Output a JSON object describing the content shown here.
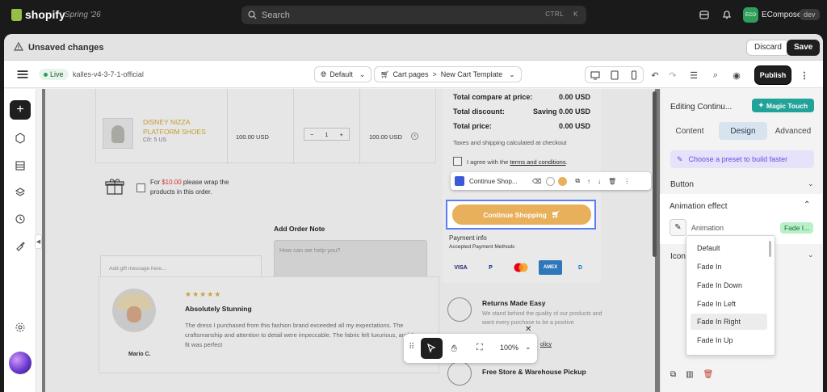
{
  "topbar": {
    "brand": "shopify",
    "edition": "Spring '26",
    "search_placeholder": "Search",
    "shortcut_ctrl": "CTRL",
    "shortcut_key": "K",
    "store_initials": "ECO",
    "store_name": "EComposer",
    "dev_badge": "dev"
  },
  "unsaved": {
    "message": "Unsaved changes",
    "discard": "Discard",
    "save": "Save"
  },
  "toolbar": {
    "live": "Live",
    "project": "kalles-v4-3-7-1-official",
    "language": "Default",
    "breadcrumb_1": "Cart pages",
    "breadcrumb_sep": ">",
    "breadcrumb_2": "New Cart Template",
    "publish": "Publish"
  },
  "cart": {
    "product_name": "DISNEY NIZZA PLATFORM SHOES",
    "product_size": "Cỡ: 5 US",
    "price": "100.00 USD",
    "qty_minus": "−",
    "qty": "1",
    "qty_plus": "+",
    "line_total": "100.00 USD",
    "gift_prefix": "For ",
    "gift_price": "$10.00",
    "gift_suffix": " please wrap the products in this order.",
    "gift_placeholder": "Add gift message here...",
    "note_heading": "Add Order Note",
    "note_placeholder": "How can we help you?"
  },
  "review": {
    "stars": "★★★★★",
    "title": "Absolutely Stunning",
    "body": "The dress I purchased from this fashion brand exceeded all my expectations. The craftsmanship and attention to detail were impeccable. The fabric felt luxurious, and the fit was perfect",
    "author": "Mario C."
  },
  "summary": {
    "compare_label": "Total compare at price:",
    "compare_value": "0.00 USD",
    "discount_label": "Total discount:",
    "discount_value": "Saving 0.00 USD",
    "total_label": "Total price:",
    "total_value": "0.00 USD",
    "tax_note": "Taxes and shipping calculated at checkout",
    "agree_prefix": "I agree with the ",
    "agree_link": "terms and conditions",
    "agree_suffix": ".",
    "float_label": "Continue Shop...",
    "cta": "Continue Shopping",
    "payment_info": "Payment info",
    "accepted": "Accepted Payment Methods",
    "cards": [
      "VISA",
      "P",
      "MC",
      "AMEX",
      "D"
    ]
  },
  "features": {
    "f1_title": "Returns Made Easy",
    "f1_body": "We stand behind the quality of our products and want every purchase to be a positive",
    "f1_link": "olicy",
    "f2_title": "Free Store & Warehouse Pickup"
  },
  "canvas_toolbar": {
    "zoom": "100%"
  },
  "panel": {
    "title": "Editing Continu...",
    "magic": "Magic Touch",
    "tabs": [
      "Content",
      "Design",
      "Advanced"
    ],
    "active_tab": "Design",
    "preset": "Choose a preset to build faster",
    "section_button": "Button",
    "section_animation": "Animation effect",
    "animation_label": "Animation",
    "animation_value": "Fade I...",
    "section_icon": "Icon",
    "options": [
      "Default",
      "Fade In",
      "Fade In Down",
      "Fade In Left",
      "Fade In Right",
      "Fade In Up"
    ],
    "highlighted_option": "Fade In Right"
  },
  "colors": {
    "accent_cta": "#e9b05c",
    "magic_touch": "#22a39a",
    "selection": "#5a7ef5",
    "product_name": "#c29a2f"
  }
}
